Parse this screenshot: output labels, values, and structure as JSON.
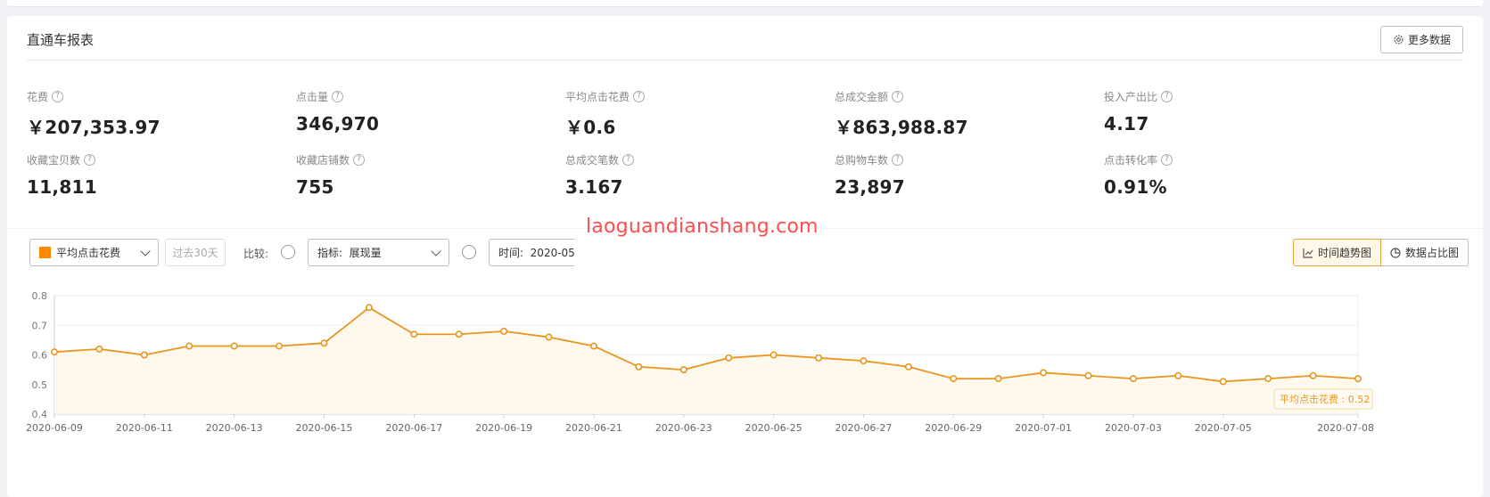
{
  "report": {
    "title": "直通车报表",
    "more_button": "更多数据",
    "metrics": [
      {
        "label": "花费",
        "value": "￥207,353.97"
      },
      {
        "label": "点击量",
        "value": "346,970"
      },
      {
        "label": "平均点击花费",
        "value": "￥0.6"
      },
      {
        "label": "总成交金额",
        "value": "￥863,988.87"
      },
      {
        "label": "投入产出比",
        "value": "4.17"
      },
      {
        "label": "收藏宝贝数",
        "value": "11,811"
      },
      {
        "label": "收藏店铺数",
        "value": "755"
      },
      {
        "label": "总成交笔数",
        "value": "3.167"
      },
      {
        "label": "总购物车数",
        "value": "23,897"
      },
      {
        "label": "点击转化率",
        "value": "0.91%"
      }
    ]
  },
  "toolbar": {
    "metric_select": "平均点击花费",
    "period": "过去30天",
    "compare_label": "比较:",
    "indicator_select": "指标:  展现量",
    "time_field": "时间:  2020-05-",
    "view_trend": "时间趋势图",
    "view_share": "数据占比图"
  },
  "watermark": "laoguandianshang.com",
  "colors": {
    "series": "#e8961e",
    "swatch": "#ff8a00",
    "watermark": "#ff4d4f"
  },
  "chart_data": {
    "type": "line",
    "x": [
      "2020-06-09",
      "2020-06-10",
      "2020-06-11",
      "2020-06-12",
      "2020-06-13",
      "2020-06-14",
      "2020-06-15",
      "2020-06-16",
      "2020-06-17",
      "2020-06-18",
      "2020-06-19",
      "2020-06-20",
      "2020-06-21",
      "2020-06-22",
      "2020-06-23",
      "2020-06-24",
      "2020-06-25",
      "2020-06-26",
      "2020-06-27",
      "2020-06-28",
      "2020-06-29",
      "2020-06-30",
      "2020-07-01",
      "2020-07-02",
      "2020-07-03",
      "2020-07-04",
      "2020-07-05",
      "2020-07-06",
      "2020-07-07",
      "2020-07-08"
    ],
    "x_ticks": [
      "2020-06-09",
      "2020-06-11",
      "2020-06-13",
      "2020-06-15",
      "2020-06-17",
      "2020-06-19",
      "2020-06-21",
      "2020-06-23",
      "2020-06-25",
      "2020-06-27",
      "2020-06-29",
      "2020-07-01",
      "2020-07-03",
      "2020-07-05",
      "2020-07-08"
    ],
    "series": [
      {
        "name": "平均点击花费",
        "values": [
          0.61,
          0.62,
          0.6,
          0.63,
          0.63,
          0.63,
          0.64,
          0.76,
          0.67,
          0.67,
          0.68,
          0.66,
          0.63,
          0.56,
          0.55,
          0.59,
          0.6,
          0.59,
          0.58,
          0.56,
          0.52,
          0.52,
          0.54,
          0.53,
          0.52,
          0.53,
          0.51,
          0.52,
          0.53,
          0.52
        ]
      }
    ],
    "ylim": [
      0.4,
      0.8
    ],
    "y_ticks": [
      "0.8",
      "0.7",
      "0.6",
      "0.5",
      "0.4"
    ],
    "grid": true,
    "tooltip": "平均点击花费 : 0.52"
  }
}
